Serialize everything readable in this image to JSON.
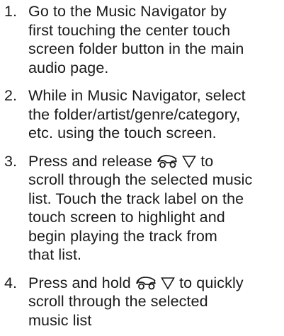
{
  "steps": [
    {
      "number": "1.",
      "lines": [
        "Go to the Music Navigator by",
        "first touching the center touch",
        "screen folder button in the main",
        "audio page."
      ]
    },
    {
      "number": "2.",
      "lines": [
        "While in Music Navigator, select",
        "the folder/artist/genre/category,",
        "etc. using the touch screen."
      ]
    },
    {
      "number": "3.",
      "first_prefix": "Press and release",
      "first_suffix": "to",
      "lines": [
        "scroll through the selected music",
        "list. Touch the track label on the",
        "touch screen to highlight and",
        "begin playing the track from",
        "that list."
      ]
    },
    {
      "number": "4.",
      "first_prefix": "Press and hold",
      "first_suffix": "to quickly",
      "lines": [
        "scroll through the selected",
        "music list"
      ]
    }
  ],
  "icons": {
    "steering_wheel_control": "steering-wheel-control-icon",
    "down_triangle": "down-triangle-icon"
  }
}
